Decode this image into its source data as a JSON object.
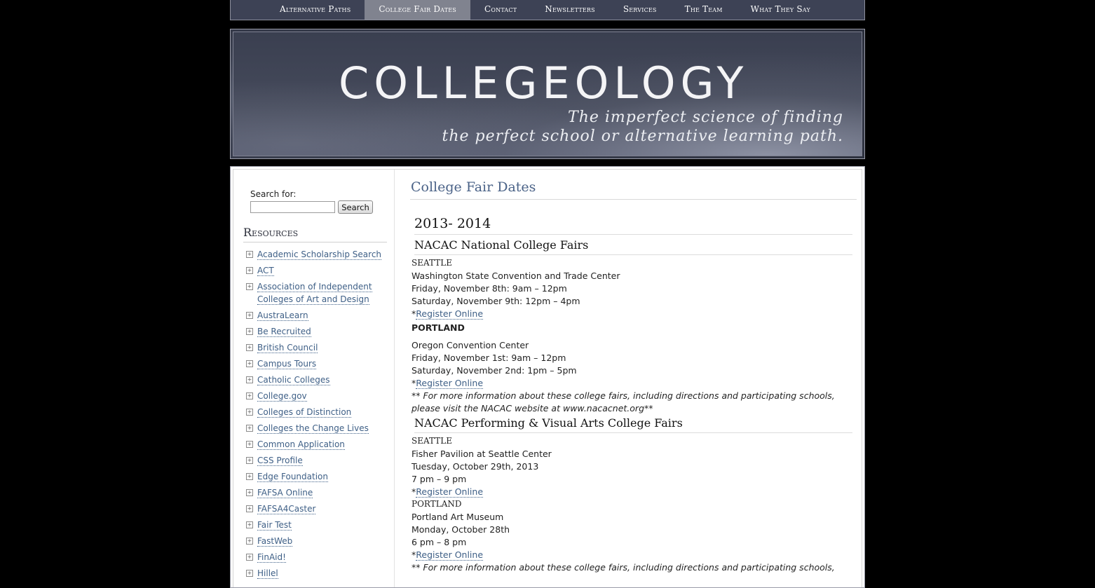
{
  "nav": {
    "items": [
      {
        "label": "Alternative Paths",
        "active": false
      },
      {
        "label": "College Fair Dates",
        "active": true
      },
      {
        "label": "Contact",
        "active": false
      },
      {
        "label": "Newsletters",
        "active": false
      },
      {
        "label": "Services",
        "active": false
      },
      {
        "label": "The Team",
        "active": false
      },
      {
        "label": "What They Say",
        "active": false
      }
    ]
  },
  "header": {
    "logo": "COLLEGEOLOGY",
    "tagline_line1": "The imperfect science of finding",
    "tagline_line2": "the perfect school or alternative learning path."
  },
  "sidebar": {
    "search_label": "Search for:",
    "search_value": "",
    "search_button": "Search",
    "resources_title": "Resources",
    "resources": [
      "Academic Scholarship Search",
      "ACT",
      "Association of Independent Colleges of Art and Design",
      "AustraLearn",
      "Be Recruited",
      "British Council",
      "Campus Tours",
      "Catholic Colleges",
      "College.gov",
      "Colleges of Distinction",
      "Colleges the Change Lives",
      "Common Application",
      "CSS Profile",
      "Edge Foundation",
      "FAFSA Online",
      "FAFSA4Caster",
      "Fair Test",
      "FastWeb",
      "FinAid!",
      "Hillel"
    ]
  },
  "main": {
    "page_title": "College Fair Dates",
    "year_heading": "2013- 2014",
    "section1": {
      "heading": "NACAC National College Fairs",
      "seattle_city": "SEATTLE",
      "seattle_venue": "Washington State Convention and Trade Center",
      "seattle_day1": "Friday, November 8th: 9am – 12pm",
      "seattle_day2": "Saturday, November 9th: 12pm – 4pm",
      "asterisk": "*",
      "register": "Register Online",
      "portland_city": "PORTLAND",
      "portland_venue": "Oregon Convention Center",
      "portland_day1": "Friday, November 1st: 9am – 12pm",
      "portland_day2": "Saturday, November 2nd: 1pm – 5pm",
      "note_line1": "** For more information about these college fairs, including directions and participating schools,",
      "note_line2": "please visit the NACAC website at www.nacacnet.org**"
    },
    "section2": {
      "heading": "NACAC Performing & Visual Arts College Fairs",
      "seattle_city": "SEATTLE",
      "seattle_venue": "Fisher Pavilion at Seattle Center",
      "seattle_date": "Tuesday, October 29th, 2013",
      "seattle_time": "7 pm – 9 pm",
      "asterisk": "*",
      "register": "Register Online",
      "portland_city": "PORTLAND",
      "portland_venue": "Portland Art Museum",
      "portland_date": "Monday, October 28th",
      "portland_time": "6 pm – 8 pm",
      "note_line1": "** For more information about these college fairs, including directions and participating schools,"
    }
  }
}
